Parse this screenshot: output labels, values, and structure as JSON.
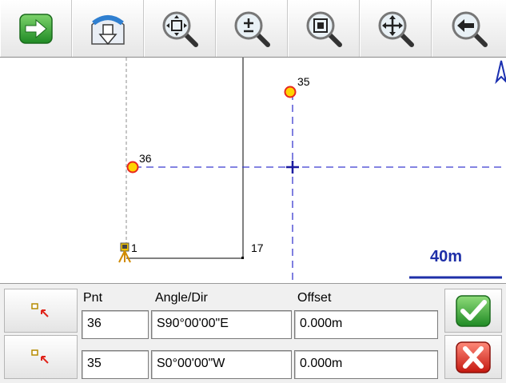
{
  "toolbar": {
    "buttons": [
      {
        "name": "proceed-button",
        "icon": "green-arrow-right-icon"
      },
      {
        "name": "pan-compass-button",
        "icon": "compass-down-arrow-icon"
      },
      {
        "name": "zoom-extents-button",
        "icon": "zoom-extents-icon"
      },
      {
        "name": "zoom-in-out-button",
        "icon": "zoom-plus-minus-icon"
      },
      {
        "name": "zoom-window-button",
        "icon": "zoom-window-icon"
      },
      {
        "name": "zoom-pan-button",
        "icon": "zoom-pan-icon"
      },
      {
        "name": "zoom-previous-button",
        "icon": "zoom-back-icon"
      }
    ]
  },
  "map": {
    "points": [
      {
        "id": "36",
        "label": "36"
      },
      {
        "id": "35",
        "label": "35"
      },
      {
        "id": "1",
        "label": "1"
      },
      {
        "id": "17",
        "label": "17"
      }
    ],
    "scale_label": "40m",
    "colors": {
      "point_fill": "#ffd400",
      "point_ring": "#e8261e",
      "dashed_line": "#3a3ad0",
      "scale": "#1e2fa8"
    }
  },
  "table": {
    "headers": {
      "pnt": "Pnt",
      "angle": "Angle/Dir",
      "offset": "Offset"
    },
    "rows": [
      {
        "pnt": "36",
        "angle": "S90°00'00\"E",
        "offset": "0.000m"
      },
      {
        "pnt": "35",
        "angle": "S0°00'00\"W",
        "offset": "0.000m"
      }
    ]
  },
  "actions": {
    "accept_icon": "green-check-icon",
    "cancel_icon": "red-x-icon"
  }
}
